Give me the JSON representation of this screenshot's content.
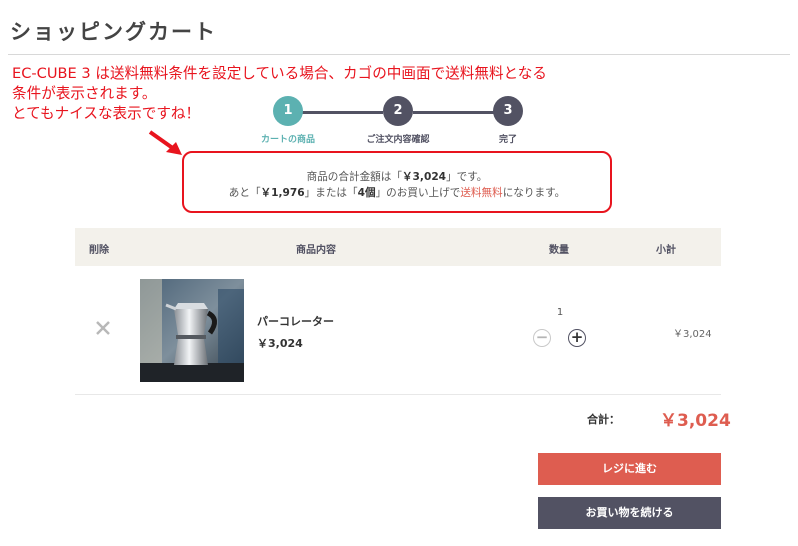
{
  "page": {
    "title": "ショッピングカート"
  },
  "annotation": {
    "lines": [
      "EC-CUBE 3 は送料無料条件を設定している場合、カゴの中画面で送料無料となる",
      "条件が表示されます。",
      "とてもナイスな表示ですね！"
    ]
  },
  "steps": [
    {
      "number": "1",
      "label": "カートの商品",
      "active": true
    },
    {
      "number": "2",
      "label": "ご注文内容確認",
      "active": false
    },
    {
      "number": "3",
      "label": "完了",
      "active": false
    }
  ],
  "notice": {
    "line1_pre": "商品の合計金額は「",
    "line1_amount": "￥3,024",
    "line1_post": "」です。",
    "line2_pre": "あと「",
    "line2_amount": "￥1,976",
    "line2_mid1": "」または「",
    "line2_count": "4個",
    "line2_mid2": "」のお買い上げで",
    "line2_free": "送料無料",
    "line2_post": "になります。"
  },
  "table": {
    "headers": {
      "remove": "削除",
      "item": "商品内容",
      "quantity": "数量",
      "subtotal": "小計"
    },
    "rows": [
      {
        "name": "パーコレーター",
        "price": "￥3,024",
        "quantity": "1",
        "subtotal": "￥3,024"
      }
    ]
  },
  "summary": {
    "total_label": "合計：",
    "total_value": "￥3,024"
  },
  "buttons": {
    "checkout": "レジに進む",
    "continue": "お買い物を続ける"
  },
  "colors": {
    "accent": "#de5d50",
    "step_active": "#5cb1b1",
    "step_inactive": "#525263",
    "annotation": "#e8141e"
  },
  "icons": {
    "remove": "close-icon",
    "minus": "minus-icon",
    "plus": "plus-icon",
    "arrow": "arrow-icon"
  }
}
